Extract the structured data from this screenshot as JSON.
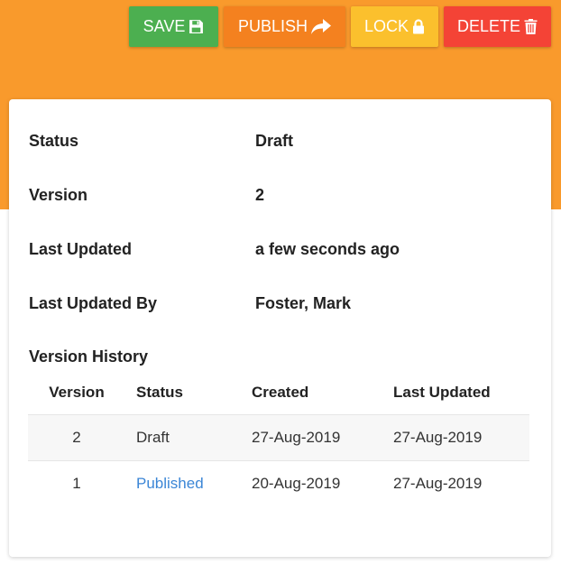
{
  "toolbar": {
    "save_label": "SAVE",
    "save_icon": "floppy-disk-icon",
    "publish_label": "PUBLISH",
    "publish_icon": "share-arrow-icon",
    "lock_label": "LOCK",
    "lock_icon": "padlock-icon",
    "delete_label": "DELETE",
    "delete_icon": "trash-icon"
  },
  "colors": {
    "header_background": "#f99a2c",
    "save": "#4caf50",
    "publish": "#f4811f",
    "lock": "#fbc02d",
    "delete": "#f44336",
    "link": "#3b86d6"
  },
  "details": [
    {
      "label": "Status",
      "value": "Draft"
    },
    {
      "label": "Version",
      "value": "2"
    },
    {
      "label": "Last Updated",
      "value": "a few seconds ago"
    },
    {
      "label": "Last Updated By",
      "value": "Foster, Mark"
    }
  ],
  "history": {
    "title": "Version History",
    "columns": [
      "Version",
      "Status",
      "Created",
      "Last Updated"
    ],
    "rows": [
      {
        "version": "2",
        "status": "Draft",
        "created": "27-Aug-2019",
        "last_updated": "27-Aug-2019"
      },
      {
        "version": "1",
        "status": "Published",
        "created": "20-Aug-2019",
        "last_updated": "27-Aug-2019"
      }
    ]
  }
}
